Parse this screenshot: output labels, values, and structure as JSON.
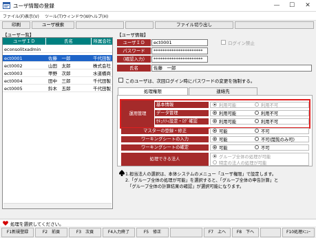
{
  "window": {
    "title": "ユーザ情報の登録",
    "controls": [
      "—",
      "☐",
      "✕"
    ]
  },
  "menu": [
    "ファイル(F)",
    "表示(V)",
    "ツール(T)",
    "ウィンドウ(W)",
    "ヘルプ(H)"
  ],
  "toolbar": {
    "print": "印刷",
    "user_search": "ユーザ検索",
    "file_switch": "ファイル切り出し"
  },
  "list_section": "【ユーザ一覧】",
  "list_headers": [
    "ユーザＩＤ",
    "氏名",
    "所属会社"
  ],
  "users": [
    {
      "id": "econsolitxadmin",
      "name": "",
      "company": ""
    },
    {
      "id": "ect0001",
      "name": "佐藤　一郎",
      "company": "千代田製"
    },
    {
      "id": "ect0002",
      "name": "山田　太郎",
      "company": "株式会社"
    },
    {
      "id": "ect0003",
      "name": "甲野　次郎",
      "company": "水道橋商"
    },
    {
      "id": "ect0004",
      "name": "田中　三郎",
      "company": "千代田製"
    },
    {
      "id": "ect0005",
      "name": "鈴木　五郎",
      "company": "千代田製"
    }
  ],
  "info_section": "【ユーザ情報】",
  "info": {
    "user_id_label": "ユーザＩＤ",
    "user_id": "ect0001",
    "password_label": "パスワード",
    "password": "**********************",
    "confirm_label": "（確認入力）",
    "confirm": "**********************",
    "name_label": "氏名",
    "name": "佐藤　一郎",
    "login_ban": "ログイン禁止",
    "force_change": "このユーザは、次回ログイン時にパスワードの変更を強制する。"
  },
  "tabs": [
    "処理権限",
    "連絡先"
  ],
  "perm": {
    "group": "運用管理",
    "rows": [
      {
        "label": "基本情報",
        "opt1": "利用可能",
        "opt2": "利用不可",
        "sel": 0,
        "disabled": true
      },
      {
        "label": "データ管理",
        "opt1": "利用可能",
        "opt2": "利用不可",
        "sel": 0,
        "disabled": false
      },
      {
        "label": "ｾｷｭﾘﾃｨ設定・ﾛｸﾞ確認",
        "opt1": "利用可能",
        "opt2": "利用不可",
        "sel": 0,
        "disabled": false
      },
      {
        "label": "マスターの登録・修正",
        "opt1": "可能",
        "opt2": "不可",
        "sel": 0,
        "disabled": false
      },
      {
        "label": "ワーキングシートの入力",
        "opt1": "可能",
        "opt2": "不可(閲覧のみ可)",
        "sel": 0,
        "disabled": false
      },
      {
        "label": "ワーキングシートの確定",
        "opt1": "可能",
        "opt2": "不可",
        "sel": 0,
        "disabled": false
      }
    ],
    "target_label": "処理できる法人",
    "target_opt1": "グループ全体の処理が可能",
    "target_opt2": "特定の法人の処理が可能"
  },
  "notes": [
    "1.担当法人の選択は、本体システムのメニュー「ユーザ権限」で設定します。",
    "2.「グループ全体の処理が可能」を選択すると、「グループ全体の申告計算」と",
    "　「グループ全体の計算結果の確認」が選択可能になります。"
  ],
  "status_text": "処理を選択してください。",
  "fkeys": [
    "F1新規登録",
    "F2　前頁",
    "F3　次頁",
    "F4入力終了",
    "F5　修正",
    "F7　上へ",
    "F8　下へ",
    "F10処理ﾒﾆｭｰ"
  ],
  "colors": {
    "header_teal": "#008080",
    "label_red": "#a52a2a",
    "selection": "#1e64c8",
    "highlight_box": "#e02020"
  }
}
